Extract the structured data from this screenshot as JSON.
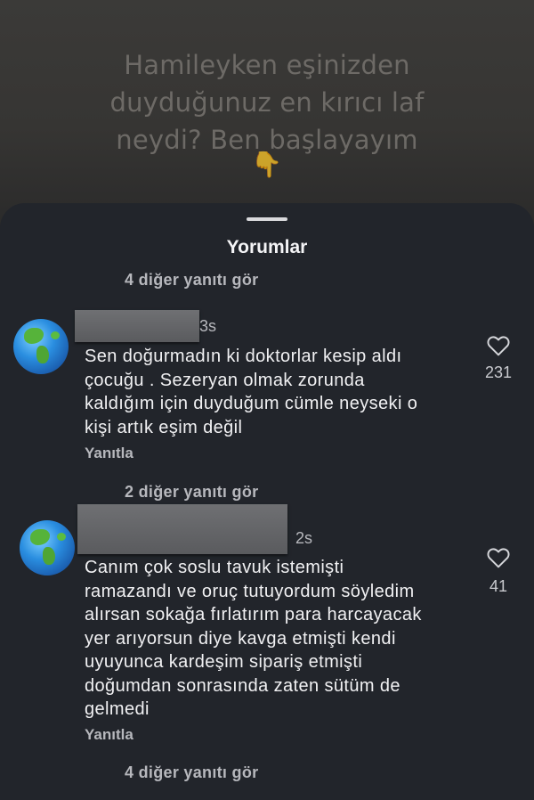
{
  "video": {
    "caption_lines": [
      "Hamileyken eşinizden",
      "duyduğunuz en kırıcı laf",
      "neydi? Ben başlayayım"
    ],
    "pointer_emoji": "👇"
  },
  "sheet": {
    "title": "Yorumlar"
  },
  "threads": [
    {
      "more_replies_top": "4 diğer yanıtı gör",
      "time": "3s",
      "text_lines": [
        "Sen doğurmadın ki doktorlar kesip aldı",
        "çocuğu . Sezeryan olmak zorunda",
        "kaldığım için duyduğum cümle neyseki o",
        "kişi artık eşim değil"
      ],
      "reply_label": "Yanıtla",
      "like_count": "231",
      "more_replies": "2 diğer yanıtı gör"
    },
    {
      "time": "2s",
      "text_lines": [
        "Canım çok soslu tavuk istemişti",
        "ramazandı ve oruç tutuyordum söyledim",
        "alırsan sokağa fırlatırım para harcayacak",
        "yer arıyorsun diye kavga etmişti kendi",
        "uyuyunca kardeşim sipariş etmişti",
        "doğumdan sonrasında zaten sütüm de",
        "gelmedi"
      ],
      "reply_label": "Yanıtla",
      "like_count": "41",
      "more_replies": "4 diğer yanıtı gör"
    }
  ],
  "icons": {
    "avatar": "earth-globe-icon",
    "like": "heart-outline-icon"
  },
  "colors": {
    "sheet_bg": "#22252b",
    "secondary_text": "#b7b8bd"
  }
}
